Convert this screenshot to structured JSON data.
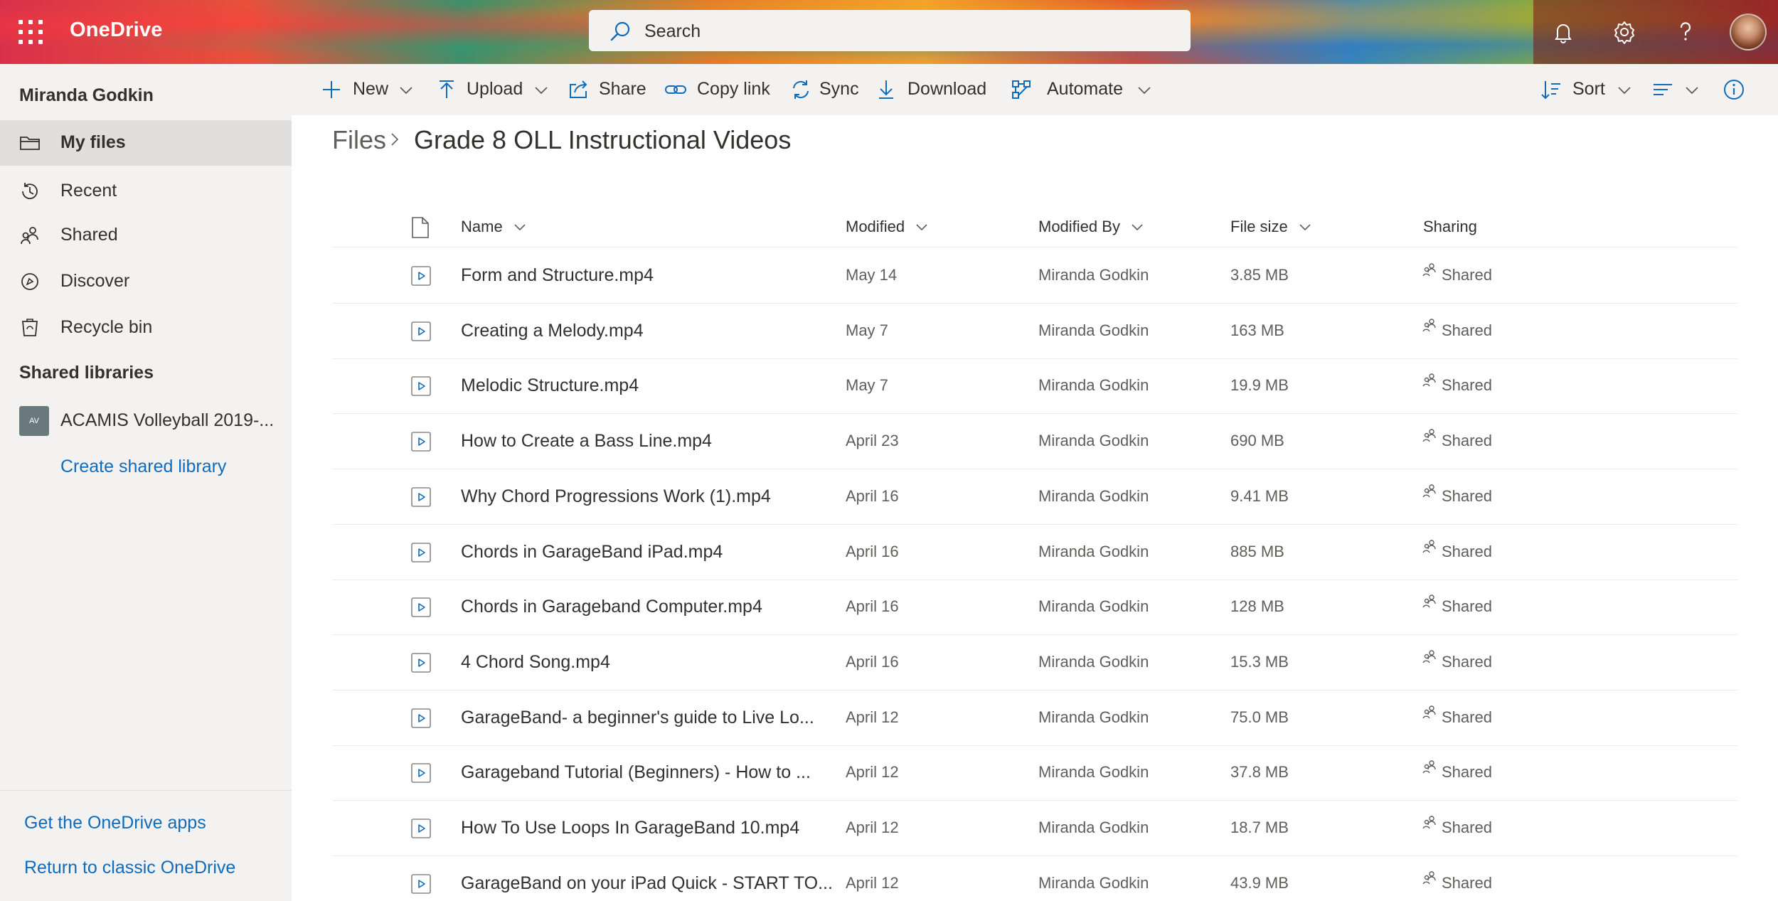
{
  "header": {
    "app_name": "OneDrive",
    "search_placeholder": "Search",
    "icons": [
      "app-launcher-icon",
      "bell-icon",
      "gear-icon",
      "help-icon",
      "user-avatar"
    ]
  },
  "nav": {
    "user_name": "Miranda Godkin",
    "items": [
      {
        "label": "My files",
        "icon": "folder-icon",
        "selected": true
      },
      {
        "label": "Recent",
        "icon": "history-icon"
      },
      {
        "label": "Shared",
        "icon": "people-icon"
      },
      {
        "label": "Discover",
        "icon": "compass-icon"
      },
      {
        "label": "Recycle bin",
        "icon": "recycle-bin-icon"
      }
    ],
    "shared_libraries_title": "Shared libraries",
    "library": {
      "initials": "AV",
      "label": "ACAMIS Volleyball 2019-..."
    },
    "create_library": "Create shared library",
    "get_apps": "Get the OneDrive apps",
    "return_classic": "Return to classic OneDrive"
  },
  "commands": {
    "new": "New",
    "upload": "Upload",
    "share": "Share",
    "copy_link": "Copy link",
    "sync": "Sync",
    "download": "Download",
    "automate": "Automate",
    "sort": "Sort"
  },
  "breadcrumb": {
    "root": "Files",
    "current": "Grade 8 OLL Instructional Videos"
  },
  "columns": {
    "name": "Name",
    "modified": "Modified",
    "modified_by": "Modified By",
    "file_size": "File size",
    "sharing": "Sharing"
  },
  "files": [
    {
      "name": "Form and Structure.mp4",
      "modified": "May 14",
      "by": "Miranda Godkin",
      "size": "3.85 MB",
      "sharing": "Shared"
    },
    {
      "name": "Creating a Melody.mp4",
      "modified": "May 7",
      "by": "Miranda Godkin",
      "size": "163 MB",
      "sharing": "Shared"
    },
    {
      "name": "Melodic Structure.mp4",
      "modified": "May 7",
      "by": "Miranda Godkin",
      "size": "19.9 MB",
      "sharing": "Shared"
    },
    {
      "name": "How to Create a Bass Line.mp4",
      "modified": "April 23",
      "by": "Miranda Godkin",
      "size": "690 MB",
      "sharing": "Shared"
    },
    {
      "name": "Why Chord Progressions Work (1).mp4",
      "modified": "April 16",
      "by": "Miranda Godkin",
      "size": "9.41 MB",
      "sharing": "Shared"
    },
    {
      "name": "Chords in GarageBand iPad.mp4",
      "modified": "April 16",
      "by": "Miranda Godkin",
      "size": "885 MB",
      "sharing": "Shared"
    },
    {
      "name": "Chords in Garageband Computer.mp4",
      "modified": "April 16",
      "by": "Miranda Godkin",
      "size": "128 MB",
      "sharing": "Shared"
    },
    {
      "name": "4 Chord Song.mp4",
      "modified": "April 16",
      "by": "Miranda Godkin",
      "size": "15.3 MB",
      "sharing": "Shared"
    },
    {
      "name": "GarageBand- a beginner's guide to Live Lo...",
      "modified": "April 12",
      "by": "Miranda Godkin",
      "size": "75.0 MB",
      "sharing": "Shared"
    },
    {
      "name": "Garageband Tutorial (Beginners) - How to ...",
      "modified": "April 12",
      "by": "Miranda Godkin",
      "size": "37.8 MB",
      "sharing": "Shared"
    },
    {
      "name": "How To Use Loops In GarageBand 10.mp4",
      "modified": "April 12",
      "by": "Miranda Godkin",
      "size": "18.7 MB",
      "sharing": "Shared"
    },
    {
      "name": "GarageBand on your iPad Quick - START TO...",
      "modified": "April 12",
      "by": "Miranda Godkin",
      "size": "43.9 MB",
      "sharing": "Shared"
    }
  ],
  "colors": {
    "accent": "#0f6cbd",
    "nav_bg": "#f3f2f1",
    "selected_bg": "#e1dfdd",
    "text": "#323130",
    "muted": "#605e5c"
  }
}
